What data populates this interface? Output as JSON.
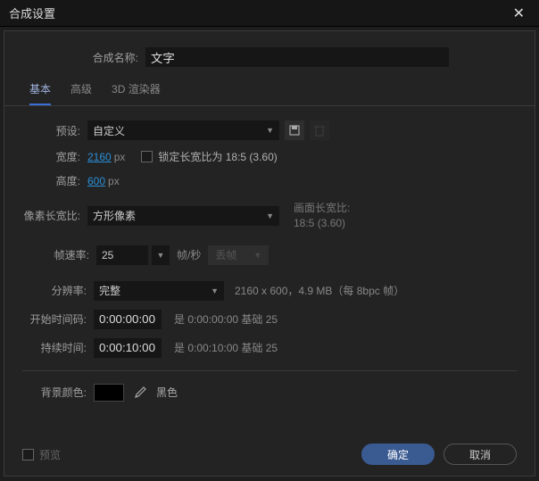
{
  "title": "合成设置",
  "comp_name_label": "合成名称:",
  "comp_name_value": "文字",
  "tabs": {
    "basic": "基本",
    "advanced": "高级",
    "renderer": "3D 渲染器"
  },
  "preset": {
    "label": "预设:",
    "value": "自定义"
  },
  "width": {
    "label": "宽度:",
    "value": "2160",
    "unit": "px"
  },
  "height": {
    "label": "高度:",
    "value": "600",
    "unit": "px"
  },
  "lock_aspect": "锁定长宽比为 18:5 (3.60)",
  "pixel_aspect": {
    "label": "像素长宽比:",
    "value": "方形像素"
  },
  "frame_aspect": {
    "label": "画面长宽比:",
    "value": "18:5 (3.60)"
  },
  "frame_rate": {
    "label": "帧速率:",
    "value": "25",
    "unit": "帧/秒",
    "drop": "丢帧"
  },
  "resolution": {
    "label": "分辨率:",
    "value": "完整",
    "info": "2160 x 600，4.9 MB（每 8bpc 帧）"
  },
  "start": {
    "label": "开始时间码:",
    "value": "0:00:00:00",
    "base": "是 0:00:00:00 基础 25"
  },
  "duration": {
    "label": "持续时间:",
    "value": "0:00:10:00",
    "base": "是 0:00:10:00 基础 25"
  },
  "background": {
    "label": "背景颜色:",
    "name": "黑色",
    "color": "#000000"
  },
  "preview": "预览",
  "buttons": {
    "ok": "确定",
    "cancel": "取消"
  }
}
